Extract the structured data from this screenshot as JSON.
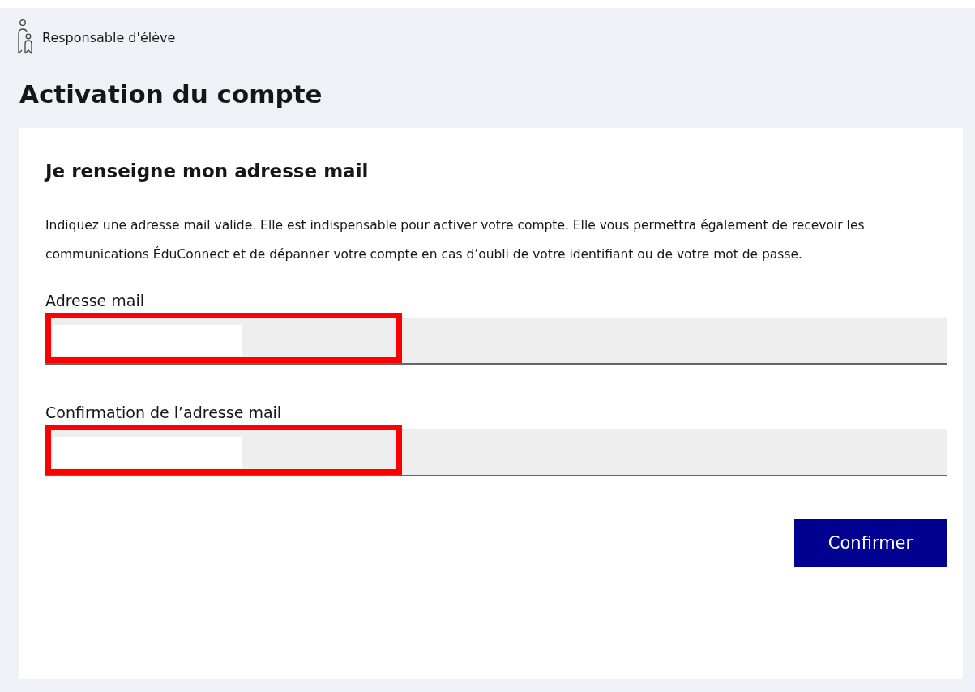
{
  "header": {
    "role": "Responsable d'élève"
  },
  "page_title": "Activation du compte",
  "card": {
    "title": "Je renseigne mon adresse mail",
    "description": "Indiquez une adresse mail valide. Elle est indispensable pour activer votre compte. Elle vous permettra également de recevoir les communications ÉduConnect et de dépanner votre compte en cas d’oubli de votre identifiant ou de votre mot de passe.",
    "fields": [
      {
        "label": "Adresse mail",
        "highlighted": true
      },
      {
        "label": "Confirmation de l’adresse mail",
        "highlighted": true
      }
    ],
    "button": "Confirmer"
  }
}
